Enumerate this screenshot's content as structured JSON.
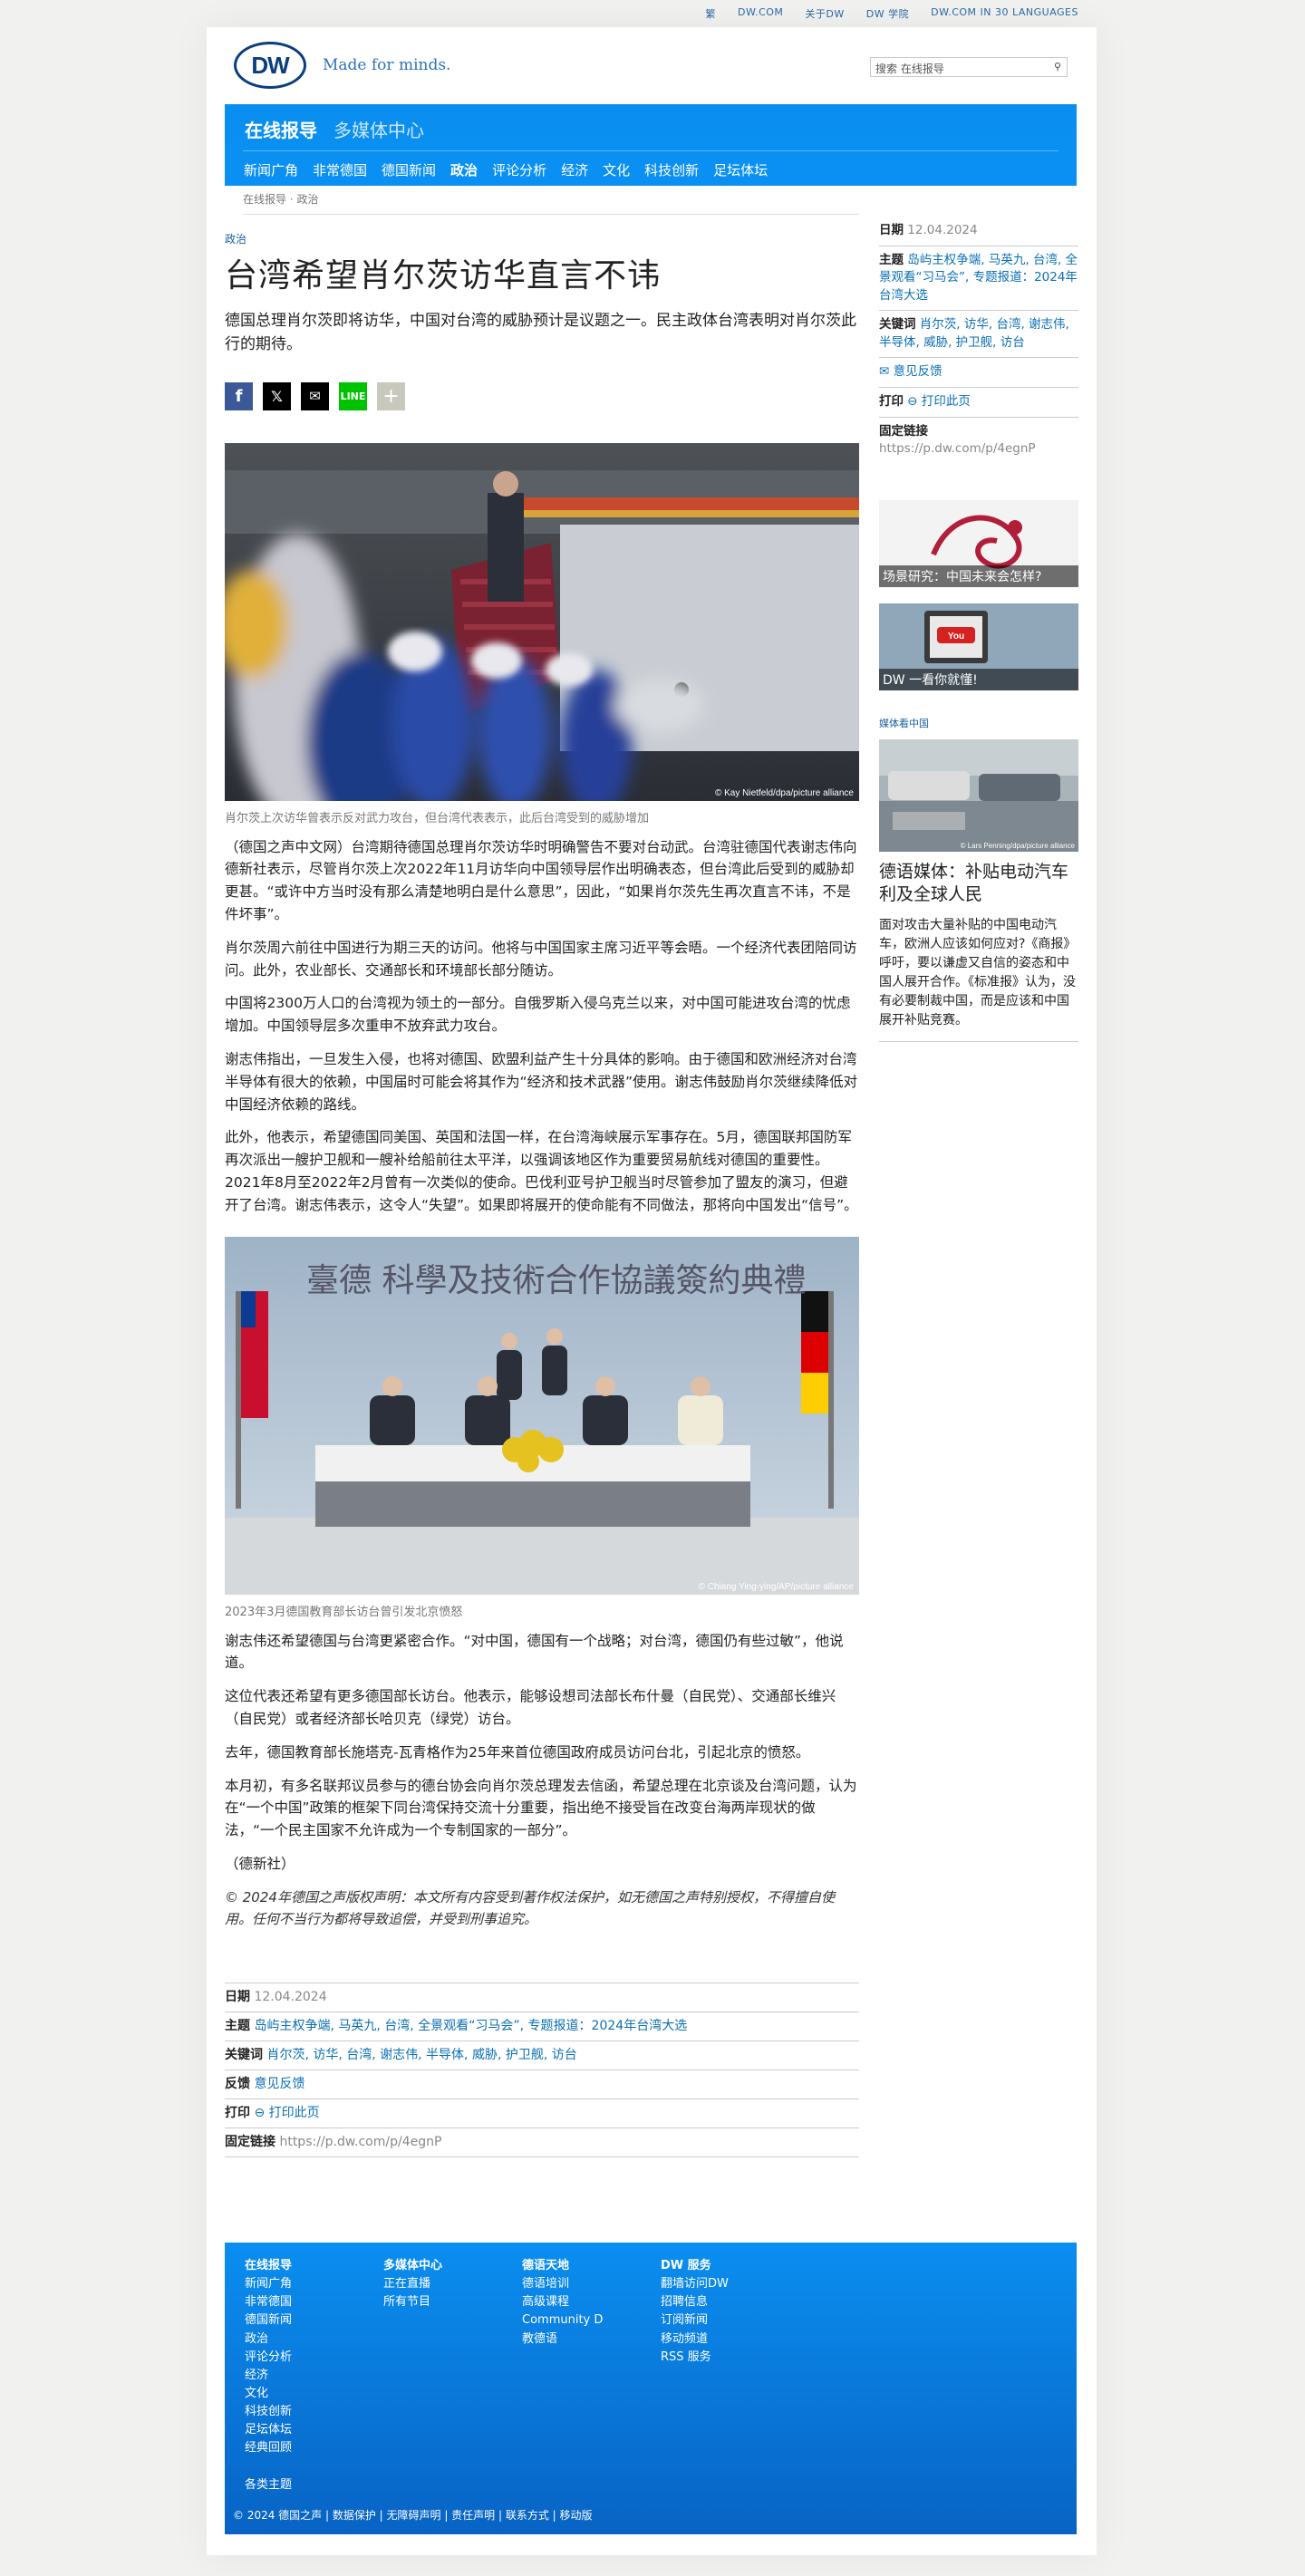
{
  "topbar": {
    "links": [
      "繁",
      "DW.COM",
      "关于DW",
      "DW 学院",
      "DW.COM IN 30 LANGUAGES"
    ]
  },
  "brand": {
    "logo": "DW",
    "tagline": "Made for minds."
  },
  "search": {
    "placeholder": "搜索 在线报导",
    "icon": "search-icon"
  },
  "nav": {
    "sections": [
      "在线报导",
      "多媒体中心"
    ],
    "items": [
      "新闻广角",
      "非常德国",
      "德国新闻",
      "政治",
      "评论分析",
      "经济",
      "文化",
      "科技创新",
      "足坛体坛"
    ],
    "active": "政治"
  },
  "breadcrumb": "在线报导 · 政治",
  "article": {
    "kicker": "政治",
    "title": "台湾希望肖尔茨访华直言不讳",
    "lead": "德国总理肖尔茨即将访华，中国对台湾的威胁预计是议题之一。民主政体台湾表明对肖尔茨此行的期待。",
    "share_icons": [
      "facebook-icon",
      "x-icon",
      "mail-icon",
      "line-icon",
      "plus-icon"
    ],
    "image1_credit": "© Kay Nietfeld/dpa/picture alliance",
    "image1_caption": "肖尔茨上次访华曾表示反对武力攻台，但台湾代表表示，此后台湾受到的威胁增加",
    "p1": "（德国之声中文网）台湾期待德国总理肖尔茨访华时明确警告不要对台动武。台湾驻德国代表谢志伟向德新社表示，尽管肖尔茨上次2022年11月访华向中国领导层作出明确表态，但台湾此后受到的威胁却更甚。“或许中方当时没有那么清楚地明白是什么意思”，因此，“如果肖尔茨先生再次直言不讳，不是件坏事”。",
    "p2": "肖尔茨周六前往中国进行为期三天的访问。他将与中国国家主席习近平等会晤。一个经济代表团陪同访问。此外，农业部长、交通部长和环境部长部分随访。",
    "p3": "中国将2300万人口的台湾视为领土的一部分。自俄罗斯入侵乌克兰以来，对中国可能进攻台湾的忧虑增加。中国领导层多次重申不放弃武力攻台。",
    "p4": "谢志伟指出，一旦发生入侵，也将对德国、欧盟利益产生十分具体的影响。由于德国和欧洲经济对台湾半导体有很大的依赖，中国届时可能会将其作为“经济和技术武器”使用。谢志伟鼓励肖尔茨继续降低对中国经济依赖的路线。",
    "p5": "此外，他表示，希望德国同美国、英国和法国一样，在台湾海峡展示军事存在。5月，德国联邦国防军再次派出一艘护卫舰和一艘补给船前往太平洋，以强调该地区作为重要贸易航线对德国的重要性。2021年8月至2022年2月曾有一次类似的使命。巴伐利亚号护卫舰当时尽管参加了盟友的演习，但避开了台湾。谢志伟表示，这令人“失望”。如果即将展开的使命能有不同做法，那将向中国发出“信号”。",
    "image2_banner": "臺德 科學及技術合作協議簽約典禮",
    "image2_credit": "© Chiang Ying-ying/AP/picture alliance",
    "image2_caption": "2023年3月德国教育部长访台曾引发北京愤怒",
    "p6": "谢志伟还希望德国与台湾更紧密合作。“对中国，德国有一个战略；对台湾，德国仍有些过敏”，他说道。",
    "p7": "这位代表还希望有更多德国部长访台。他表示，能够设想司法部长布什曼（自民党）、交通部长维兴（自民党）或者经济部长哈贝克（绿党）访台。",
    "p8": "去年，德国教育部长施塔克-瓦青格作为25年来首位德国政府成员访问台北，引起北京的愤怒。",
    "p9": "本月初，有多名联邦议员参与的德台协会向肖尔茨总理发去信函，希望总理在北京谈及台湾问题，认为在“一个中国”政策的框架下同台湾保持交流十分重要，指出绝不接受旨在改变台海两岸现状的做法，“一个民主国家不允许成为一个专制国家的一部分”。",
    "p10": "（德新社）",
    "copyright": "© 2024年德国之声版权声明：本文所有内容受到著作权法保护，如无德国之声特别授权，不得擅自使用。任何不当行为都将导致追偿，并受到刑事追究。"
  },
  "meta": {
    "date_label": "日期",
    "date": "12.04.2024",
    "topics_label": "主题",
    "topics": "岛屿主权争端, 马英九, 台湾, 全景观看“习马会”, 专题报道：2024年台湾大选",
    "keywords_label": "关键词",
    "keywords": "肖尔茨, 访华, 台湾, 谢志伟, 半导体, 威胁, 护卫舰, 访台",
    "feedback_label": "反馈",
    "feedback": "意见反馈",
    "print_label": "打印",
    "print": "打印此页",
    "link_label": "固定链接",
    "link": "https://p.dw.com/p/4egnP"
  },
  "sidebar": {
    "teaser1": "场景研究：中国未来会怎样?",
    "teaser2": "DW 一看你就懂!",
    "media_label": "媒体看中国",
    "story_credit": "© Lars Penning/dpa/picture alliance",
    "story_title": "德语媒体：补贴电动汽车利及全球人民",
    "story_text": "面对攻击大量补贴的中国电动汽车，欧洲人应该如何应对?《商报》呼吁，要以谦虚又自信的姿态和中国人展开合作。《标准报》认为，没有必要制裁中国，而是应该和中国展开补贴竞赛。"
  },
  "footer": {
    "col1": {
      "title": "在线报导",
      "items": [
        "新闻广角",
        "非常德国",
        "德国新闻",
        "政治",
        "评论分析",
        "经济",
        "文化",
        "科技创新",
        "足坛体坛",
        "经典回顾"
      ]
    },
    "col2": {
      "title": "多媒体中心",
      "items": [
        "正在直播",
        "所有节目"
      ]
    },
    "col3": {
      "title": "德语天地",
      "items": [
        "德语培训",
        "高级课程",
        "Community D",
        "教德语"
      ]
    },
    "col4": {
      "title": "DW 服务",
      "items": [
        "翻墙访问DW",
        "招聘信息",
        "订阅新闻",
        "移动频道",
        "RSS 服务"
      ]
    },
    "all_topics": "各类主题",
    "bottom": "© 2024 德国之声 | 数据保护 | 无障碍声明 | 责任声明 | 联系方式 | 移动版"
  },
  "colors": {
    "brand_blue": "#0a8ff0",
    "link": "#0a6fb5",
    "logo_navy": "#0a3e80"
  }
}
